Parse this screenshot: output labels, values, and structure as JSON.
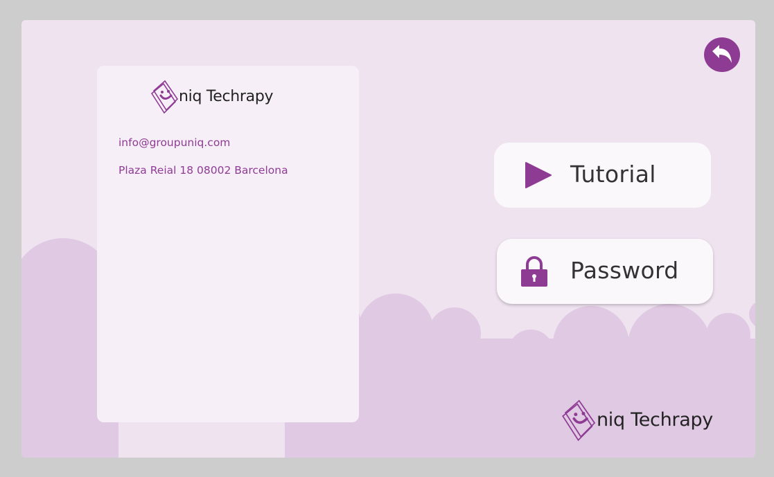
{
  "brand": {
    "name": "niq Techrapy"
  },
  "contact": {
    "email": "info@groupuniq.com",
    "address": "Plaza Reial 18 08002 Barcelona"
  },
  "menu": {
    "tutorial_label": "Tutorial",
    "password_label": "Password"
  },
  "icons": {
    "back": "undo-arrow-icon",
    "tutorial": "play-icon",
    "password": "lock-icon",
    "logo": "smiley-tablet-logo"
  },
  "colors": {
    "accent": "#8e3b94",
    "background": "#efe3f0",
    "clouds": "#e0c9e3",
    "card": "#f7eff7",
    "pill": "#fbf8fb",
    "frame": "#cdcdcd"
  }
}
